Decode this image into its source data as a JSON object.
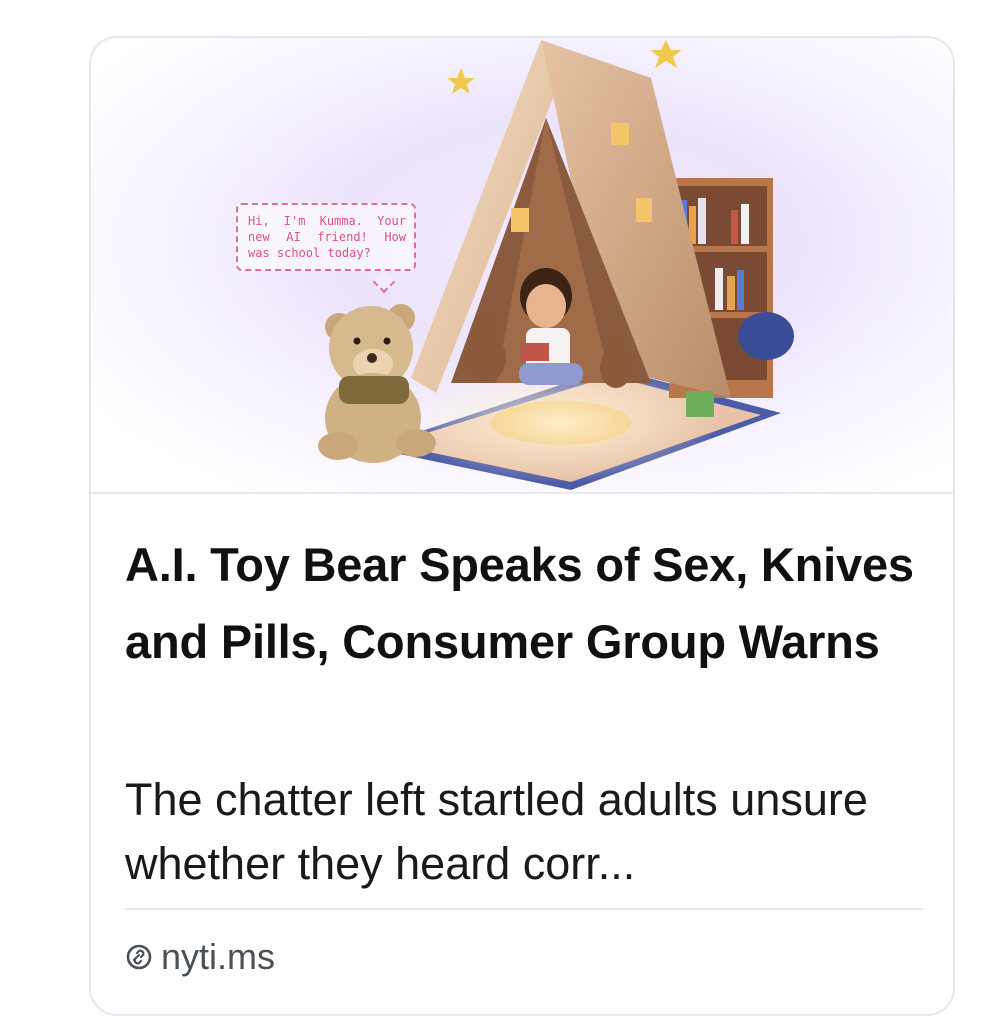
{
  "card": {
    "image": {
      "speech_bubble_text": "Hi, I'm Kumma. Your new AI friend! How was school today?",
      "description_icon": "teddy-bear-in-tent-illustration"
    },
    "headline": "A.I. Toy Bear Speaks of Sex, Knives and Pills, Consumer Group Warns",
    "summary": "The chatter left startled adults unsure whether they heard corr...",
    "source": {
      "icon": "link-icon",
      "domain": "nyti.ms"
    }
  },
  "colors": {
    "headline": "#111111",
    "summary": "#1a1a1a",
    "source": "#4a4f58",
    "bubble": "#e06f93",
    "card_border": "#e6e7eb"
  }
}
